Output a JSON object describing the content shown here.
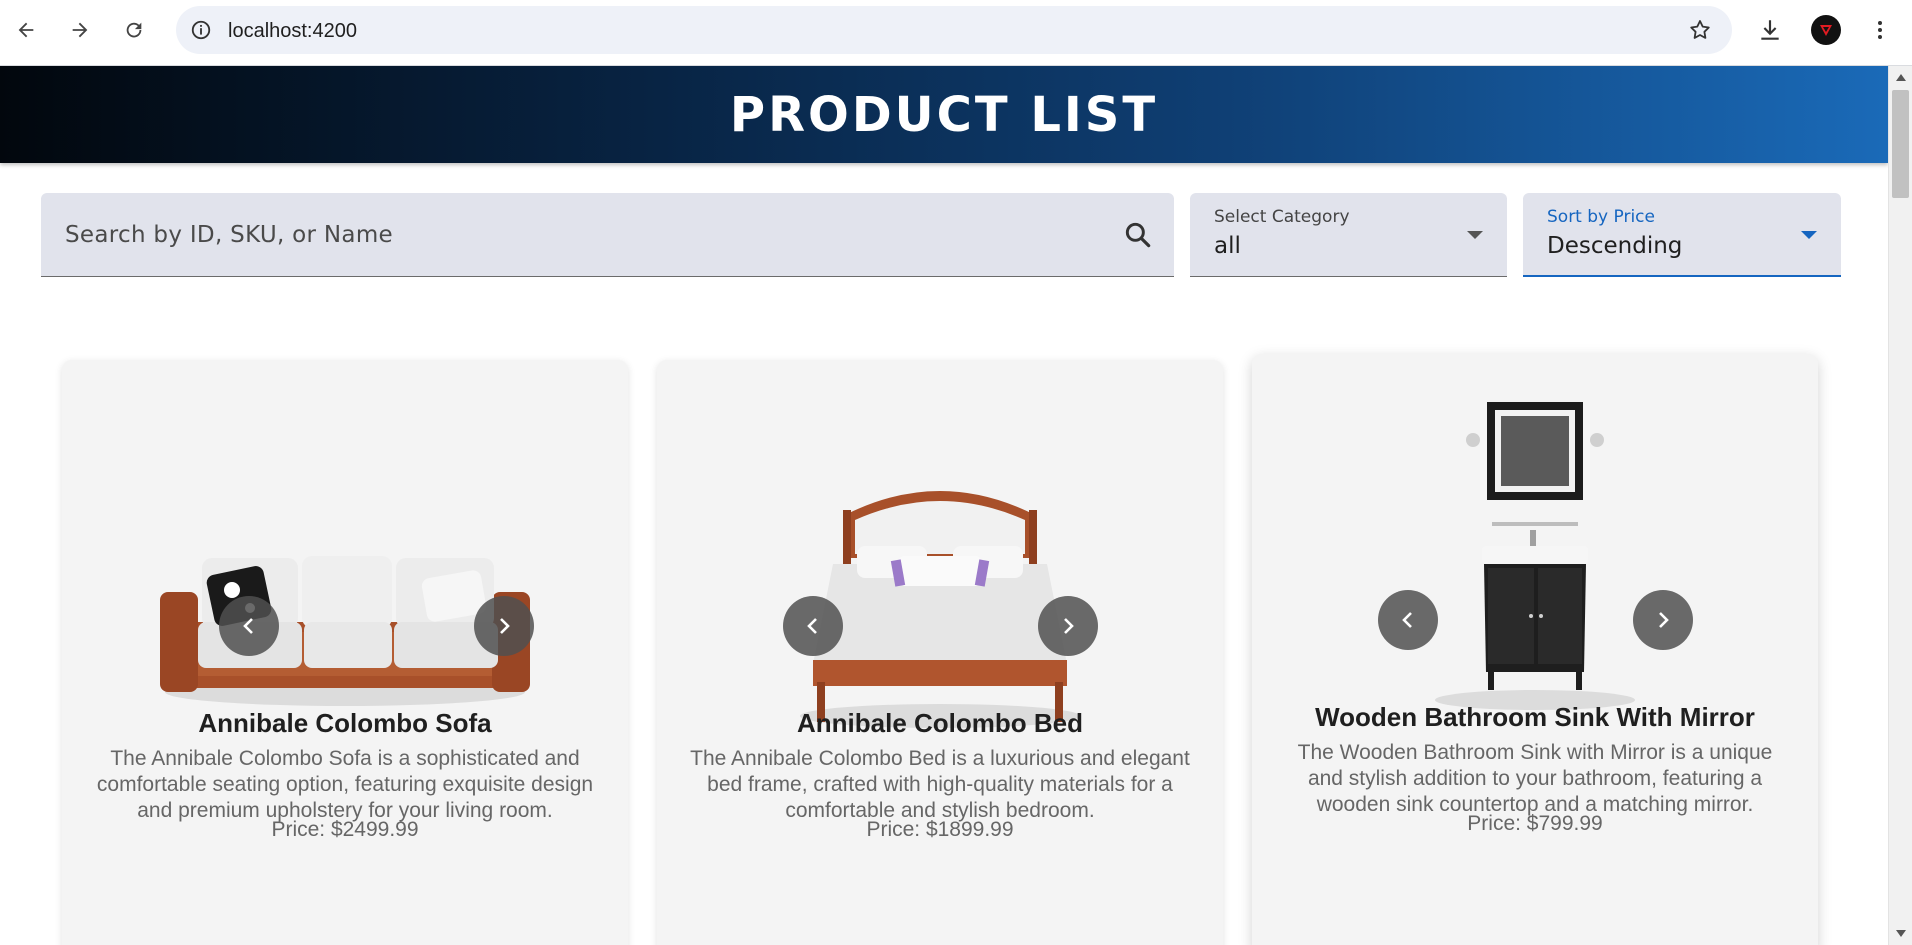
{
  "browser": {
    "url": "localhost:4200",
    "back_icon": "arrow-left-icon",
    "forward_icon": "arrow-right-icon",
    "reload_icon": "reload-icon",
    "info_icon": "info-icon",
    "bookmark_icon": "star-icon",
    "download_icon": "download-icon",
    "profile_icon": "profile-avatar-icon",
    "menu_icon": "more-vert-icon"
  },
  "header": {
    "title": "PRODUCT LIST"
  },
  "filters": {
    "search": {
      "placeholder": "Search by ID, SKU, or Name",
      "value": ""
    },
    "category": {
      "label": "Select Category",
      "value": "all"
    },
    "sort": {
      "label": "Sort by Price",
      "value": "Descending"
    }
  },
  "products": [
    {
      "name": "Annibale Colombo Sofa",
      "description": "The Annibale Colombo Sofa is a sophisticated and comfortable seating option, featuring exquisite design and premium upholstery for your living room.",
      "price": "Price: $2499.99"
    },
    {
      "name": "Annibale Colombo Bed",
      "description": "The Annibale Colombo Bed is a luxurious and elegant bed frame, crafted with high-quality materials for a comfortable and stylish bedroom.",
      "price": "Price: $1899.99"
    },
    {
      "name": "Wooden Bathroom Sink With Mirror",
      "description": "The Wooden Bathroom Sink with Mirror is a unique and stylish addition to your bathroom, featuring a wooden sink countertop and a matching mirror.",
      "price": "Price: $799.99"
    }
  ],
  "colors": {
    "accent": "#1565c0",
    "banner_start": "#02070d",
    "banner_end": "#1a6ab8",
    "field_bg": "#e1e3ec",
    "card_bg": "#f4f4f4"
  }
}
